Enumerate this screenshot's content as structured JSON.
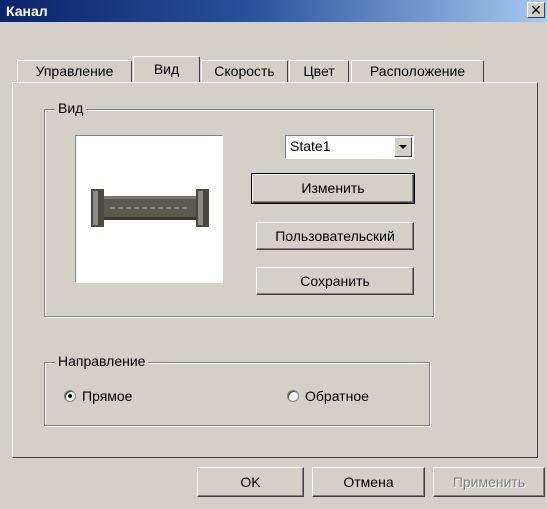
{
  "window": {
    "title": "Канал",
    "close_glyph": "✕"
  },
  "tabs": [
    {
      "label": "Управление",
      "active": false
    },
    {
      "label": "Вид",
      "active": true
    },
    {
      "label": "Скорость",
      "active": false
    },
    {
      "label": "Цвет",
      "active": false
    },
    {
      "label": "Расположение",
      "active": false
    }
  ],
  "view_group": {
    "label": "Вид",
    "state_select": {
      "value": "State1"
    },
    "buttons": {
      "change": "Изменить",
      "custom": "Пользовательский",
      "save": "Сохранить"
    },
    "preview_icon": "channel-pipe-icon"
  },
  "direction_group": {
    "label": "Направление",
    "options": [
      {
        "label": "Прямое",
        "checked": true
      },
      {
        "label": "Обратное",
        "checked": false
      }
    ]
  },
  "footer": {
    "ok": "OK",
    "cancel": "Отмена",
    "apply": "Применить",
    "apply_enabled": false
  },
  "colors": {
    "face": "#d4d0c8",
    "title_start": "#0a246a",
    "title_end": "#a6caf0",
    "disabled_text": "#808080"
  }
}
